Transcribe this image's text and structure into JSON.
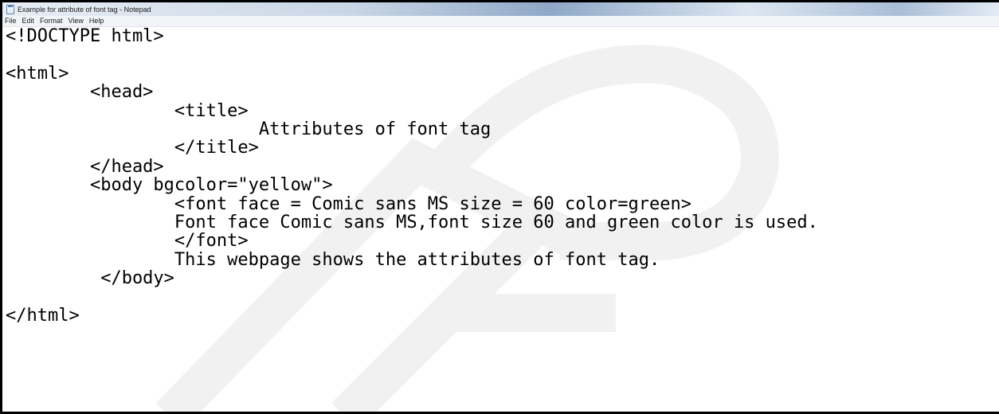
{
  "window": {
    "title": "Example for attribute of font tag - Notepad"
  },
  "menu": {
    "items": [
      "File",
      "Edit",
      "Format",
      "View",
      "Help"
    ]
  },
  "editor": {
    "lines": [
      "<!DOCTYPE html>",
      "",
      "<html>",
      "        <head>",
      "                <title>",
      "                        Attributes of font tag",
      "                </title>",
      "        </head>",
      "        <body bgcolor=\"yellow\">",
      "                <font face = Comic sans MS size = 60 color=green>",
      "                Font face Comic sans MS,font size 60 and green color is used.",
      "                </font>",
      "                This webpage shows the attributes of font tag.",
      "         </body>",
      "",
      "</html>"
    ]
  },
  "colors": {
    "watermark": "#f1f1f1"
  }
}
